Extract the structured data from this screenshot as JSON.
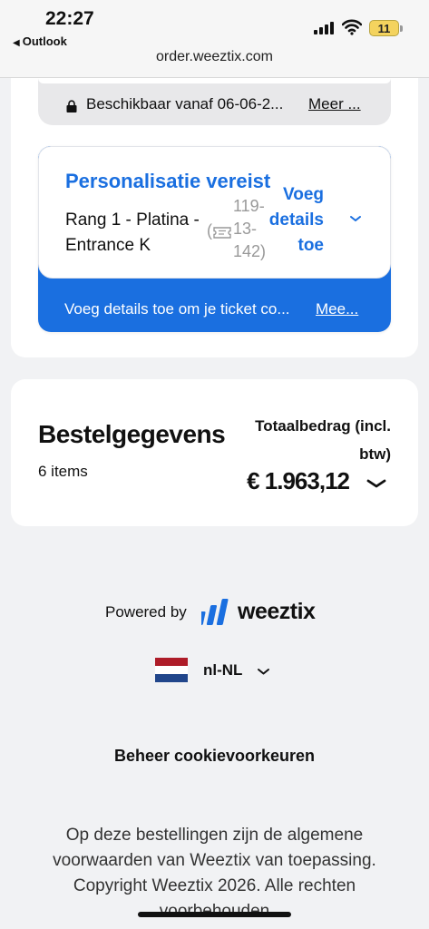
{
  "status_bar": {
    "time": "22:27",
    "back_app": "Outlook",
    "battery": "11",
    "url": "order.weeztix.com"
  },
  "availability": {
    "text": "Beschikbaar vanaf 06-06-2...",
    "more": "Meer ..."
  },
  "ticket": {
    "personalisation_title": "Personalisatie vereist",
    "rank": "Rang 1 - Platina - Entrance K",
    "ticket_id_lines": [
      "119-",
      "13-",
      "142)"
    ],
    "paren_open": "(",
    "add_details_lines": [
      "Voeg",
      "details",
      "toe"
    ],
    "footer_text": "Voeg details toe om je ticket co...",
    "footer_more": "Mee..."
  },
  "order": {
    "title": "Bestelgegevens",
    "items": "6 items",
    "total_label": "Totaalbedrag (incl. btw)",
    "total_amount": "€ 1.963,12"
  },
  "footer": {
    "powered_by": "Powered by",
    "brand": "weeztix",
    "locale": "nl-NL",
    "cookie": "Beheer cookievoorkeuren",
    "legal": "Op deze bestellingen zijn de algemene voorwaarden van Weeztix van toepassing. Copyright Weeztix 2026. Alle rechten voorbehouden"
  },
  "colors": {
    "accent": "#1a6fe0",
    "flag_red": "#ae1c28",
    "flag_white": "#ffffff",
    "flag_blue": "#21468b"
  },
  "icons": [
    "lock-icon",
    "ticket-icon",
    "chevron-down-icon",
    "weeztix-logo-icon",
    "netherlands-flag-icon",
    "signal-icon",
    "wifi-icon",
    "battery-icon"
  ]
}
